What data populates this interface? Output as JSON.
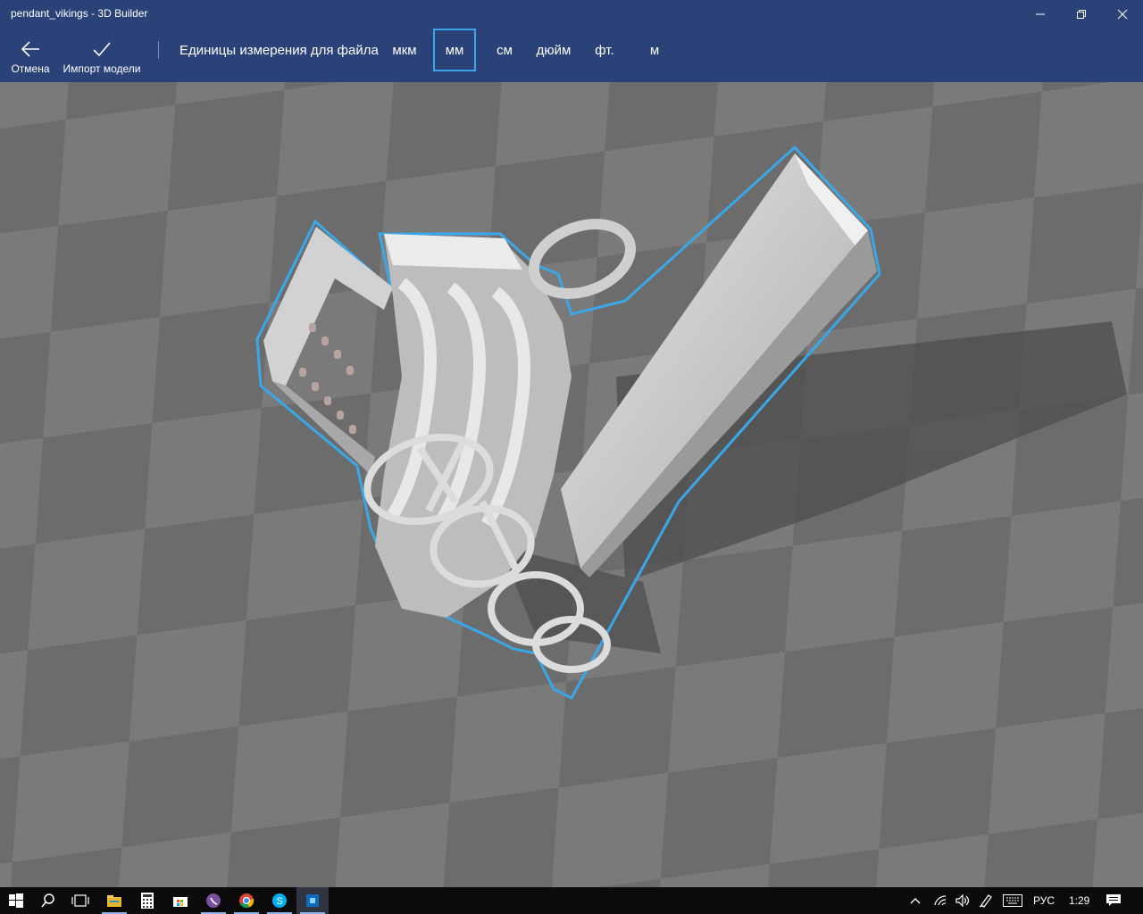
{
  "window": {
    "title": "pendant_vikings - 3D Builder"
  },
  "toolbar": {
    "cancel_label": "Отмена",
    "import_label": "Импорт модели",
    "units_caption": "Единицы измерения для файла",
    "units": [
      {
        "label": "мкм",
        "selected": false
      },
      {
        "label": "мм",
        "selected": true
      },
      {
        "label": "см",
        "selected": false
      },
      {
        "label": "дюйм",
        "selected": false
      },
      {
        "label": "фт.",
        "selected": false
      },
      {
        "label": "м",
        "selected": false
      }
    ]
  },
  "colors": {
    "accent": "#2b4279",
    "selection": "#3aa7e8",
    "grid_light": "#777777",
    "grid_dark": "#656565",
    "model": "#c9c9c9"
  },
  "taskbar": {
    "icons": [
      "windows-start-icon",
      "search-icon",
      "task-view-icon",
      "file-explorer-icon",
      "calculator-icon",
      "store-icon",
      "viber-icon",
      "chrome-icon",
      "skype-icon",
      "3d-builder-icon"
    ],
    "language": "РУС",
    "time": "1:29"
  }
}
